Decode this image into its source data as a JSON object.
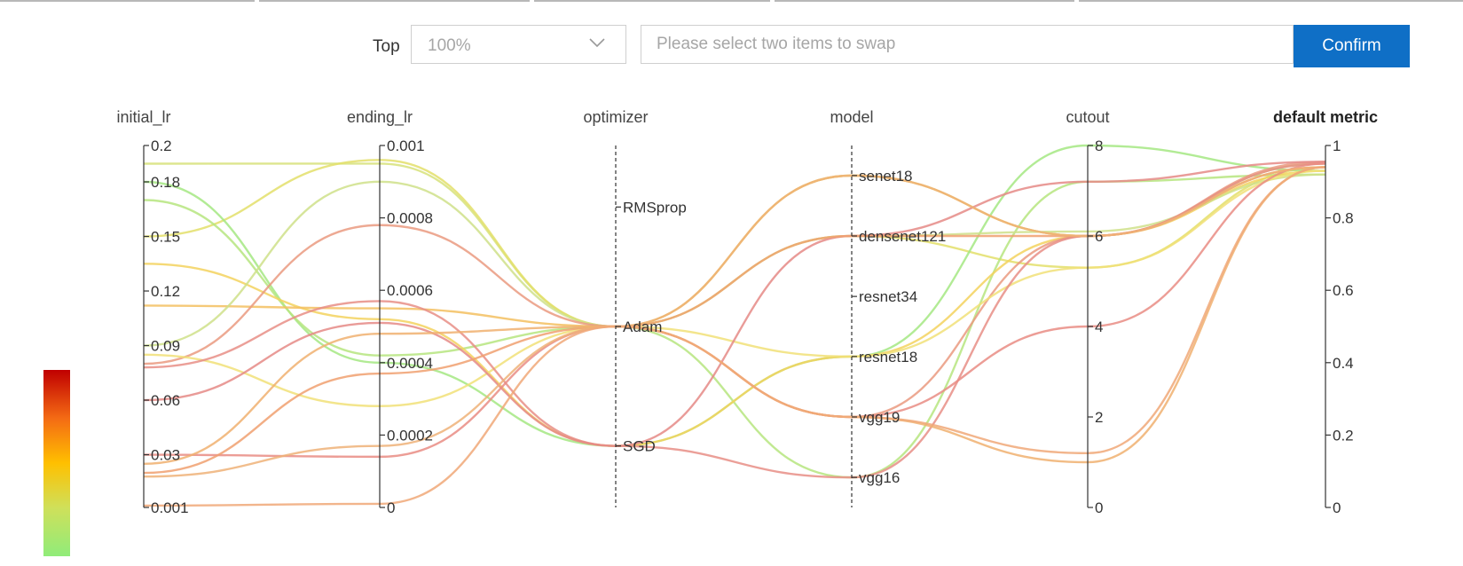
{
  "toolbar": {
    "top_label": "Top",
    "top_select_value": "100%",
    "swap_placeholder": "Please select two items to swap",
    "confirm_label": "Confirm"
  },
  "colors": {
    "accent": "#0f6fc6",
    "scale_high": "#c00000",
    "scale_mid_high": "#f46b14",
    "scale_mid": "#ffc000",
    "scale_mid_low": "#cfe05a",
    "scale_low": "#90ec7a"
  },
  "chart_data": {
    "type": "parallel_coordinates",
    "color_by": "default metric",
    "axes": [
      {
        "name": "initial_lr",
        "kind": "numeric",
        "range": [
          0.001,
          0.2
        ],
        "ticks": [
          0.2,
          0.18,
          0.15,
          0.12,
          0.09,
          0.06,
          0.03,
          0.001
        ],
        "tick_labels": [
          "0.2",
          "0.18",
          "0.15",
          "0.12",
          "0.09",
          "0.06",
          "0.03",
          "0.001"
        ],
        "bold": false
      },
      {
        "name": "ending_lr",
        "kind": "numeric",
        "range": [
          0,
          0.001
        ],
        "ticks": [
          0.001,
          0.0008,
          0.0006,
          0.0004,
          0.0002,
          0
        ],
        "tick_labels": [
          "0.001",
          "0.0008",
          "0.0006",
          "0.0004",
          "0.0002",
          "0"
        ],
        "bold": false
      },
      {
        "name": "optimizer",
        "kind": "categorical",
        "categories": [
          "RMSprop",
          "Adam",
          "SGD"
        ],
        "positions": [
          0.83,
          0.5,
          0.17
        ],
        "dashed": true,
        "bold": false
      },
      {
        "name": "model",
        "kind": "categorical",
        "categories": [
          "senet18",
          "densenet121",
          "resnet34",
          "resnet18",
          "vgg19",
          "vgg16"
        ],
        "positions": [
          0.917,
          0.75,
          0.583,
          0.417,
          0.25,
          0.083
        ],
        "dashed": true,
        "bold": false
      },
      {
        "name": "cutout",
        "kind": "numeric",
        "range": [
          0,
          8
        ],
        "ticks": [
          8,
          6,
          4,
          2,
          0
        ],
        "tick_labels": [
          "8",
          "6",
          "4",
          "2",
          "0"
        ],
        "bold": false
      },
      {
        "name": "default metric",
        "kind": "numeric",
        "range": [
          0,
          1
        ],
        "ticks": [
          1,
          0.8,
          0.6,
          0.4,
          0.2,
          0
        ],
        "tick_labels": [
          "1",
          "0.8",
          "0.6",
          "0.4",
          "0.2",
          "0"
        ],
        "bold": true
      }
    ],
    "trials": [
      {
        "initial_lr": 0.19,
        "ending_lr": 0.00095,
        "optimizer": "Adam",
        "model": "senet18",
        "cutout": 6,
        "default metric": 0.95,
        "color": "#d7e27a"
      },
      {
        "initial_lr": 0.15,
        "ending_lr": 0.00096,
        "optimizer": "Adam",
        "model": "densenet121",
        "cutout": 5.3,
        "default metric": 0.94,
        "color": "#e3df6a"
      },
      {
        "initial_lr": 0.18,
        "ending_lr": 0.0004,
        "optimizer": "SGD",
        "model": "resnet18",
        "cutout": 8,
        "default metric": 0.93,
        "color": "#a4e882"
      },
      {
        "initial_lr": 0.17,
        "ending_lr": 0.00042,
        "optimizer": "Adam",
        "model": "vgg16",
        "cutout": 7.2,
        "default metric": 0.92,
        "color": "#b6e57f"
      },
      {
        "initial_lr": 0.135,
        "ending_lr": 0.00052,
        "optimizer": "SGD",
        "model": "resnet18",
        "cutout": 6,
        "default metric": 0.93,
        "color": "#f3d25e"
      },
      {
        "initial_lr": 0.112,
        "ending_lr": 0.00055,
        "optimizer": "Adam",
        "model": "senet18",
        "cutout": 6,
        "default metric": 0.94,
        "color": "#f3c060"
      },
      {
        "initial_lr": 0.09,
        "ending_lr": 0.0009,
        "optimizer": "Adam",
        "model": "densenet121",
        "cutout": 6.1,
        "default metric": 0.92,
        "color": "#cfe08a"
      },
      {
        "initial_lr": 0.08,
        "ending_lr": 0.00078,
        "optimizer": "Adam",
        "model": "vgg19",
        "cutout": 6,
        "default metric": 0.955,
        "color": "#ea9a80"
      },
      {
        "initial_lr": 0.085,
        "ending_lr": 0.00028,
        "optimizer": "Adam",
        "model": "resnet18",
        "cutout": 5.3,
        "default metric": 0.93,
        "color": "#f1e078"
      },
      {
        "initial_lr": 0.078,
        "ending_lr": 0.00057,
        "optimizer": "SGD",
        "model": "vgg16",
        "cutout": 6,
        "default metric": 0.95,
        "color": "#e78e86"
      },
      {
        "initial_lr": 0.06,
        "ending_lr": 0.00051,
        "optimizer": "SGD",
        "model": "densenet121",
        "cutout": 7.2,
        "default metric": 0.955,
        "color": "#e58a86"
      },
      {
        "initial_lr": 0.03,
        "ending_lr": 0.00014,
        "optimizer": "Adam",
        "model": "vgg19",
        "cutout": 4,
        "default metric": 0.95,
        "color": "#e98c84"
      },
      {
        "initial_lr": 0.02,
        "ending_lr": 0.00037,
        "optimizer": "Adam",
        "model": "densenet121",
        "cutout": 6,
        "default metric": 0.94,
        "color": "#f0a070"
      },
      {
        "initial_lr": 0.018,
        "ending_lr": 0.00017,
        "optimizer": "Adam",
        "model": "senet18",
        "cutout": 6,
        "default metric": 0.94,
        "color": "#efb278"
      },
      {
        "initial_lr": 0.025,
        "ending_lr": 0.00048,
        "optimizer": "Adam",
        "model": "vgg19",
        "cutout": 1,
        "default metric": 0.94,
        "color": "#f0b070"
      },
      {
        "initial_lr": 0.002,
        "ending_lr": 1e-05,
        "optimizer": "Adam",
        "model": "vgg19",
        "cutout": 1.2,
        "default metric": 0.94,
        "color": "#f0a878"
      }
    ]
  }
}
